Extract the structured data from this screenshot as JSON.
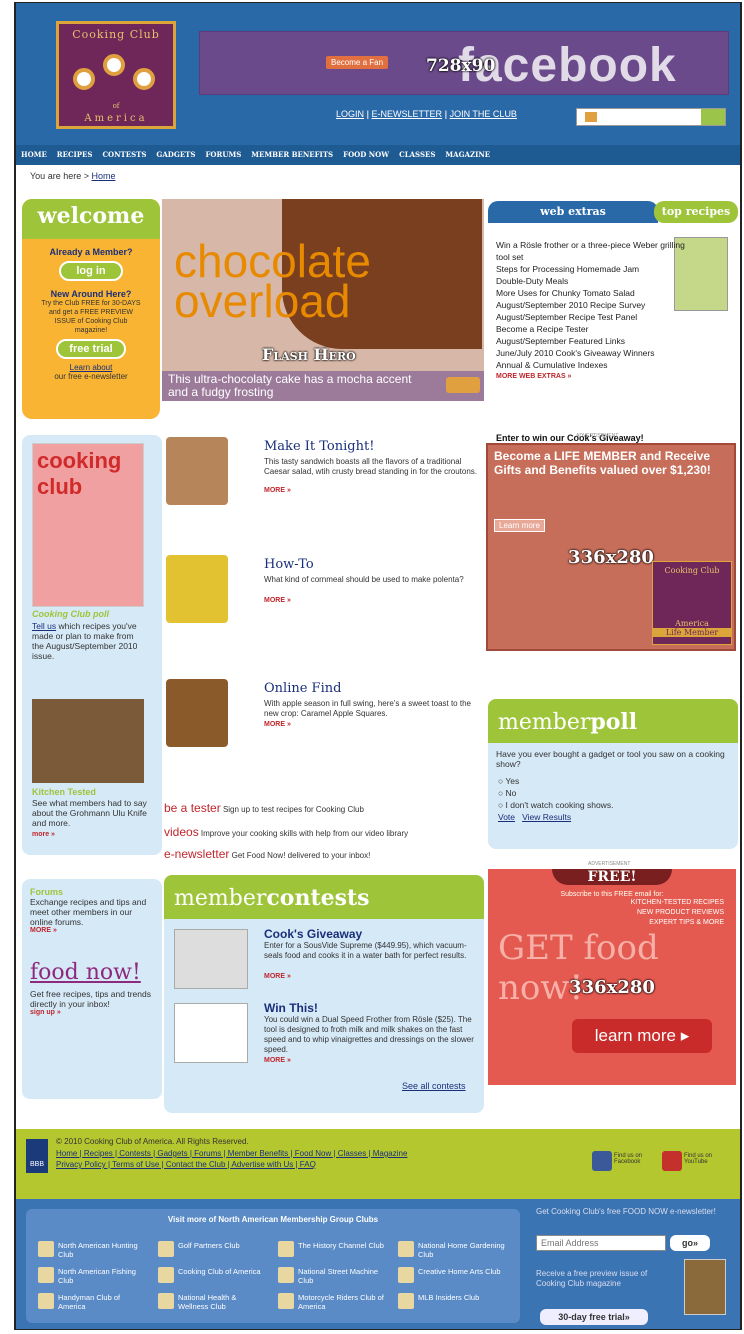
{
  "header": {
    "logo_top": "Cooking Club",
    "logo_bottom": "America",
    "logo_of": "of",
    "ad_label": "728x90",
    "fb_word": "facebook",
    "fan_button": "Become a Fan",
    "links": [
      "LOGIN",
      "E-NEWSLETTER",
      "JOIN THE CLUB"
    ],
    "sep": " | "
  },
  "nav": [
    "HOME",
    "RECIPES",
    "CONTESTS",
    "GADGETS",
    "FORUMS",
    "MEMBER BENEFITS",
    "FOOD NOW",
    "CLASSES",
    "MAGAZINE"
  ],
  "breadcrumb": {
    "prefix": "You are here >",
    "link": "Home"
  },
  "welcome": {
    "title": "welcome",
    "q1": "Already a Member?",
    "login": "log in",
    "q2": "New Around Here?",
    "desc": "Try the Club FREE for 30-DAYS and get a FREE PREVIEW ISSUE of Cooking Club magazine!",
    "trial": "free trial",
    "learn": "Learn about",
    "learn2": "our free e-newsletter"
  },
  "hero": {
    "line1": "chocolate",
    "line2": "overload",
    "label": "Flash Hero",
    "caption": "This ultra-chocolaty cake has a mocha accent and a fudgy frosting"
  },
  "webextras": {
    "tab1": "web extras",
    "tab2": "top recipes",
    "items": [
      "Win a Rösle frother or a three-piece Weber grilling tool set",
      "Steps for Processing Homemade Jam",
      "Double-Duty Meals",
      "More Uses for Chunky Tomato Salad",
      "August/September 2010 Recipe Survey",
      "August/September Recipe Test Panel",
      "Become a Recipe Tester",
      "August/September Featured Links",
      "June/July 2010 Cook's Giveaway Winners",
      "Annual & Cumulative Indexes"
    ],
    "more": "MORE WEB EXTRAS »",
    "enter": "Enter to win our Cook's Giveaway!"
  },
  "ad1": {
    "small": "ADVERTISEMENT",
    "head": "Become a LIFE MEMBER and Receive Gifts and Benefits valued over $1,230!",
    "learn": "Learn more",
    "label": "336x280",
    "badge": "Cooking Club",
    "badge2": "America",
    "badge3": "Life Member"
  },
  "leftcol": {
    "mag": "cooking club",
    "poll_title": "Cooking Club poll",
    "poll_link": "Tell us",
    "poll_text": "which recipes you've made or plan to make from the August/September 2010 issue.",
    "kt_title": "Kitchen Tested",
    "kt_text": "See what members had to say about the Grohmann Ulu Knife and more.",
    "more": "more »"
  },
  "features": [
    {
      "title": "Make It Tonight!",
      "body": "This tasty sandwich boasts all the flavors of a traditional Caesar salad, wtih crusty bread standing in for the croutons.",
      "more": "MORE »"
    },
    {
      "title": "How-To",
      "body": "What kind of cornmeal should be used to make polenta?",
      "more": "MORE »"
    },
    {
      "title": "Online Find",
      "body": "With apple season in full swing, here's a sweet toast to the new crop: Caramel Apple Squares.",
      "more": "MORE »"
    }
  ],
  "promos": [
    {
      "label": "be a tester",
      "text": "Sign up to test recipes for Cooking Club"
    },
    {
      "label": "videos",
      "text": "Improve your cooking skills with help from our video library"
    },
    {
      "label": "e-newsletter",
      "text": "Get Food Now! delivered to your inbox!"
    }
  ],
  "poll": {
    "title1": "member",
    "title2": "poll",
    "question": "Have you ever bought a gadget or tool you saw on a cooking show?",
    "options": [
      "Yes",
      "No",
      "I don't watch cooking shows."
    ],
    "vote": "Vote",
    "results": "View Results"
  },
  "ad2": {
    "small": "ADVERTISEMENT",
    "free": "FREE!",
    "sub": "Subscribe to this FREE email for:",
    "b1": "KITCHEN-TESTED RECIPES",
    "b2": "NEW PRODUCT REVIEWS",
    "b3": "EXPERT TIPS & MORE",
    "big": "GET food now!",
    "label": "336x280",
    "btn": "learn more ▸"
  },
  "forums": {
    "title": "Forums",
    "text": "Exchange recipes and tips and meet other members in our online forums.",
    "more": "MORE »",
    "fn_title": "food now!",
    "fn_text": "Get free recipes, tips and trends directly in your inbox!",
    "signup": "sign up »"
  },
  "contests": {
    "title1": "member",
    "title2": "contests",
    "c1_title": "Cook's Giveaway",
    "c1_text": "Enter for a SousVide Supreme ($449.95), which vacuum-seals food and cooks it in a water bath for perfect results.",
    "c2_title": "Win This!",
    "c2_text": "You could win a Dual Speed Frother from Rösle ($25). The tool is designed to froth milk and milk shakes on the fast speed and to whip vinaigrettes and dressings on the slower speed.",
    "more": "MORE »",
    "all": "See all contests"
  },
  "footer": {
    "copy": "© 2010 Cooking Club of America. All Rights Reserved.",
    "links1": "Home | Recipes | Contests | Gadgets | Forums | Member Benefits | Food Now | Classes | Magazine",
    "links2": "Privacy Policy | Terms of Use | Contact the Club | Advertise with Us | FAQ",
    "bbb": "BBB",
    "fb": "Find us on Facebook",
    "yt": "Find us on YouTube",
    "visit": "Visit more of North American Membership Group Clubs",
    "clubs": [
      "North American Hunting Club",
      "Golf Partners Club",
      "The History Channel Club",
      "National Home Gardening Club",
      "North American Fishing Club",
      "Cooking Club of America",
      "National Street Machine Club",
      "Creative Home Arts Club",
      "Handyman Club of America",
      "National Health & Wellness Club",
      "Motorcycle Riders Club of America",
      "MLB Insiders Club"
    ],
    "fn_get": "Get Cooking Club's free FOOD NOW e-newsletter!",
    "email_placeholder": "Email Address",
    "go": "go»",
    "preview": "Receive a free preview issue of Cooking Club magazine",
    "trial": "30-day free trial»"
  }
}
